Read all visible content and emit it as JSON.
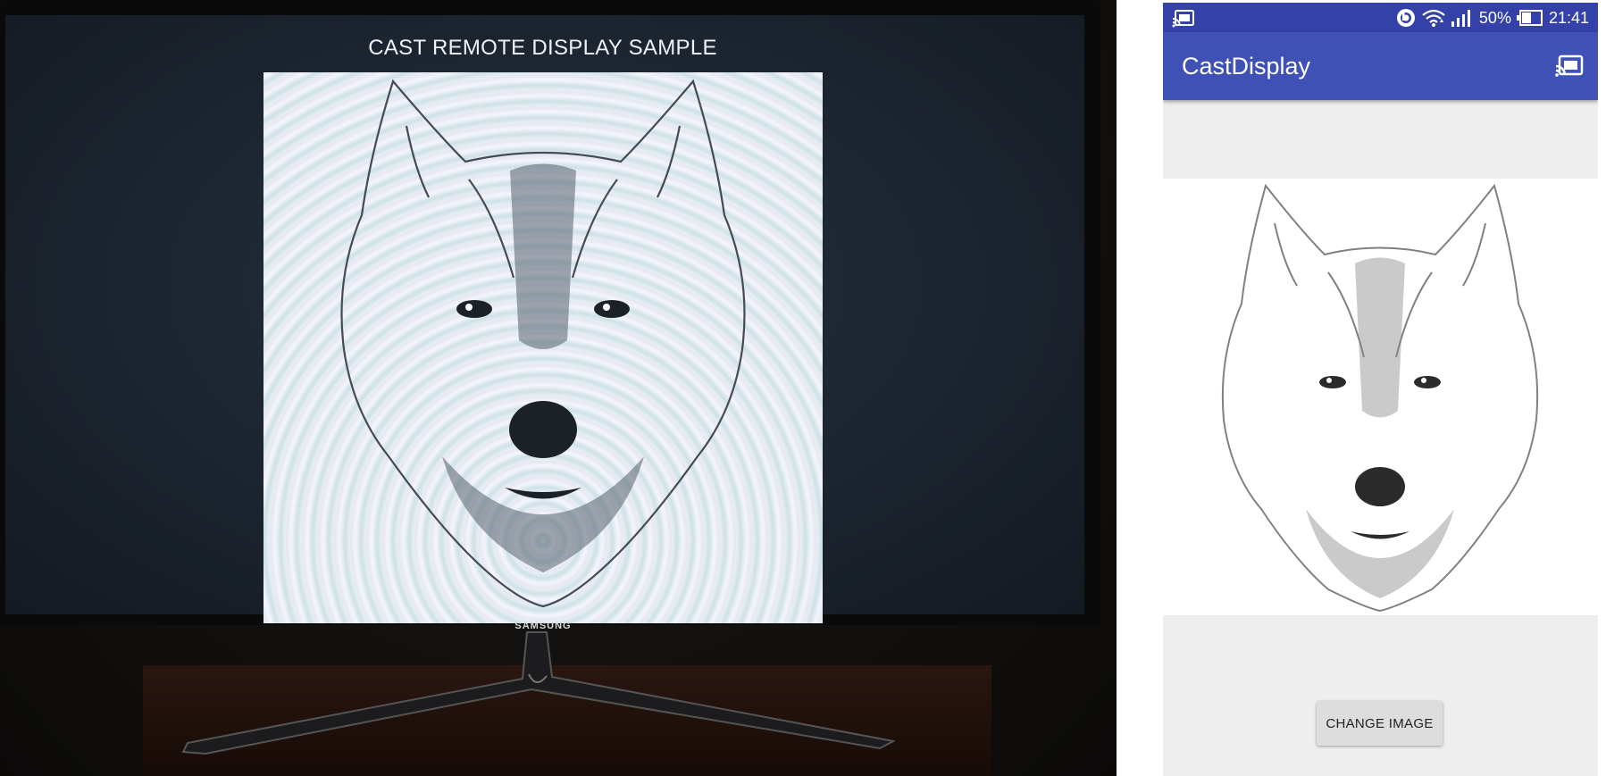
{
  "tv": {
    "screen_title": "CAST REMOTE DISPLAY SAMPLE",
    "brand": "SAMSUNG"
  },
  "phone": {
    "status_bar": {
      "cast_icon": "cast-connected-icon",
      "beats_icon": "beats-icon",
      "wifi_icon": "wifi-icon",
      "signal_icon": "cell-signal-icon",
      "battery_percent": "50%",
      "battery_icon": "battery-icon",
      "time": "21:41"
    },
    "app_bar": {
      "title": "CastDisplay",
      "cast_button_icon": "cast-connected-icon"
    },
    "content": {
      "image": "wolf-sketch-image"
    },
    "change_button_label": "CHANGE IMAGE"
  },
  "colors": {
    "status_bar": "#3441a8",
    "app_bar": "#3f51b5",
    "phone_background": "#eeeeee",
    "tv_screen": "#1b232e"
  }
}
